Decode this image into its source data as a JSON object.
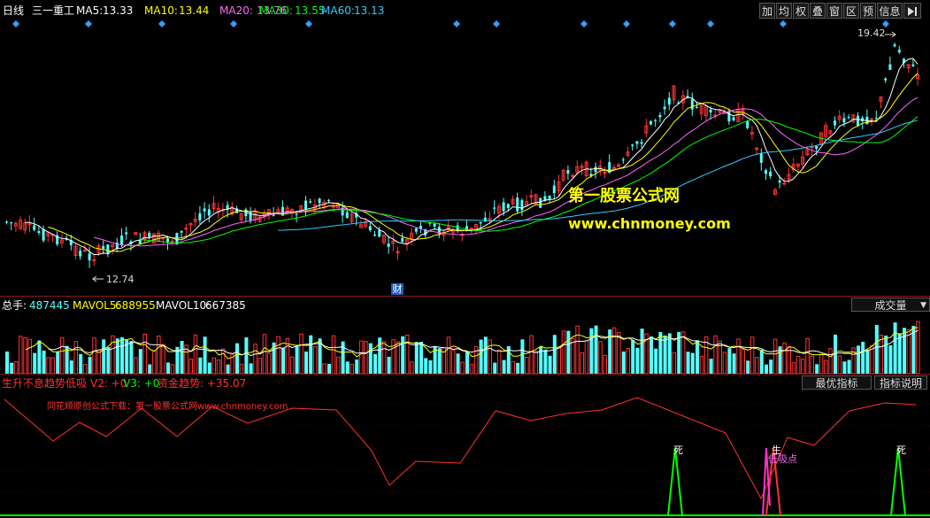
{
  "header": {
    "period": "日线",
    "stock_name": "三一重工",
    "ma": [
      {
        "label": "MA5:",
        "value": "13.33",
        "color": "#ffffff"
      },
      {
        "label": "MA10:",
        "value": "13.44",
        "color": "#ffff00"
      },
      {
        "label": "MA20:",
        "value": "13.76",
        "color": "#ff66ff"
      },
      {
        "label": "MA30:",
        "value": "13.55",
        "color": "#00ff00"
      },
      {
        "label": "MA60:",
        "value": "13.13",
        "color": "#33ccff"
      }
    ],
    "toolbar": [
      "加",
      "均",
      "权",
      "叠",
      "窗",
      "区",
      "预",
      "信息"
    ],
    "toolbar_end_icon": "arrow-right-bar-icon"
  },
  "main_chart": {
    "high_label": "19.42",
    "low_label": "12.74",
    "finance_marker": "财",
    "watermark_title": "第一股票公式网",
    "watermark_url": "www.chnmoney.com",
    "colors": {
      "up": "#ff3232",
      "down": "#54ffff",
      "ma5": "#ffffff",
      "ma10": "#ffff00",
      "ma20": "#ff66ff",
      "ma30": "#00ff00",
      "ma60": "#33ccff"
    }
  },
  "volume_panel": {
    "total_label": "总手:",
    "total_value": "487445",
    "mavol5_label": "MAVOL5:",
    "mavol5_value": "688955",
    "mavol10_label": "MAVOL10:",
    "mavol10_value": "667385",
    "selector": "成交量"
  },
  "indicator_panel": {
    "name": "生升不息趋势低吸",
    "v2": "V2: +0",
    "v3": "V3: +0",
    "trend": "资金趋势: +35.07",
    "best_button": "最优指标",
    "help_button": "指标说明",
    "credit_text": "同花顺原创公式下载：第一股票公式网www.chnmoney.com",
    "signal_death": "死",
    "signal_birth": "生",
    "signal_buy": "低吸点"
  }
}
